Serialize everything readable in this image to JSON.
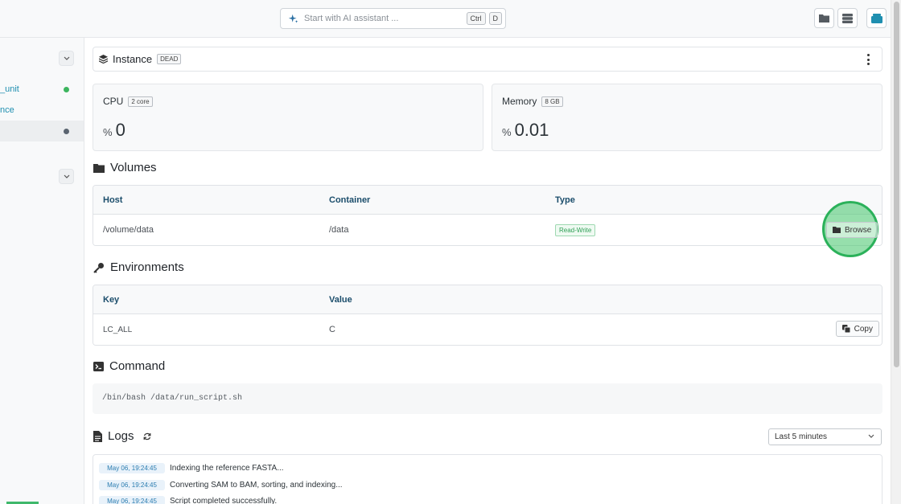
{
  "topbar": {
    "ai_placeholder": "Start with AI assistant ...",
    "shortcut_keys": [
      "Ctrl",
      "D"
    ],
    "icons": [
      "folder-icon",
      "storage-icon",
      "instances-icon"
    ]
  },
  "sidebar": {
    "items": [
      {
        "label": "_unit",
        "status_color": "#3cb55e"
      },
      {
        "label": "nce"
      },
      {
        "label": "",
        "status_color": "#5a6470"
      }
    ]
  },
  "instance": {
    "title": "Instance",
    "status": "DEAD"
  },
  "stats": {
    "cpu": {
      "label": "CPU",
      "badge": "2 core",
      "unit": "%",
      "value": "0"
    },
    "memory": {
      "label": "Memory",
      "badge": "8 GB",
      "unit": "%",
      "value": "0.01"
    }
  },
  "volumes": {
    "title": "Volumes",
    "columns": [
      "Host",
      "Container",
      "Type"
    ],
    "rows": [
      {
        "host": "/volume/data",
        "container": "/data",
        "type": "Read-Write",
        "action": "Browse"
      }
    ]
  },
  "environments": {
    "title": "Environments",
    "columns": [
      "Key",
      "Value"
    ],
    "rows": [
      {
        "key": "LC_ALL",
        "value": "C",
        "action": "Copy"
      }
    ]
  },
  "command": {
    "title": "Command",
    "text": "/bin/bash /data/run_script.sh"
  },
  "logs": {
    "title": "Logs",
    "range": "Last 5 minutes",
    "entries": [
      {
        "time": "May 06, 19:24:45",
        "message": "Indexing the reference FASTA..."
      },
      {
        "time": "May 06, 19:24:45",
        "message": "Converting SAM to BAM, sorting, and indexing..."
      },
      {
        "time": "May 06, 19:24:45",
        "message": "Script completed successfully."
      }
    ]
  },
  "colors": {
    "accent": "#1f8fb0",
    "highlight": "#2bb15a",
    "header_text": "#1b4d6b"
  }
}
